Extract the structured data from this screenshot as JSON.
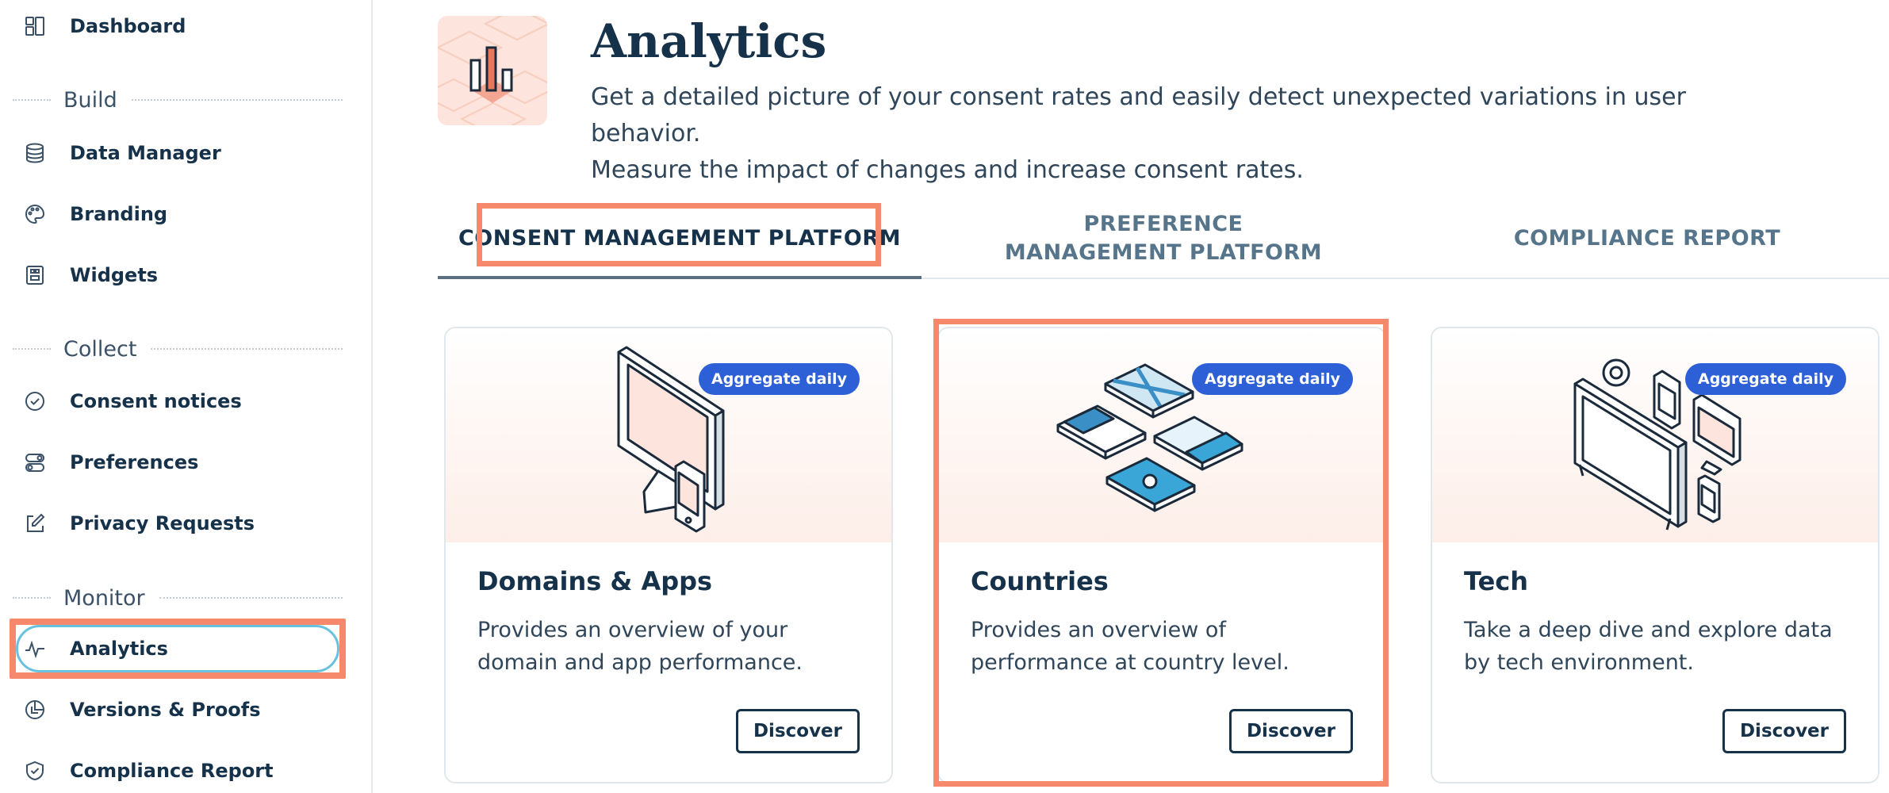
{
  "sidebar": {
    "items_top": [
      {
        "label": "Dashboard",
        "icon": "dashboard-icon"
      }
    ],
    "sections": [
      {
        "label": "Build",
        "items": [
          {
            "label": "Data Manager",
            "icon": "database-icon"
          },
          {
            "label": "Branding",
            "icon": "palette-icon"
          },
          {
            "label": "Widgets",
            "icon": "widgets-icon"
          }
        ]
      },
      {
        "label": "Collect",
        "items": [
          {
            "label": "Consent notices",
            "icon": "check-circle-icon"
          },
          {
            "label": "Preferences",
            "icon": "toggles-icon"
          },
          {
            "label": "Privacy Requests",
            "icon": "edit-icon"
          }
        ]
      },
      {
        "label": "Monitor",
        "items": [
          {
            "label": "Analytics",
            "icon": "pulse-icon",
            "active": true
          },
          {
            "label": "Versions & Proofs",
            "icon": "pie-icon"
          },
          {
            "label": "Compliance Report",
            "icon": "shield-check-icon"
          }
        ]
      }
    ]
  },
  "header": {
    "title": "Analytics",
    "description_line1": "Get a detailed picture of your consent rates and easily detect unexpected variations in user behavior.",
    "description_line2": "Measure the impact of changes and increase consent rates.",
    "icon": "bar-chart-icon"
  },
  "tabs": [
    {
      "label": "CONSENT MANAGEMENT PLATFORM",
      "active": true
    },
    {
      "label": "PREFERENCE MANAGEMENT PLATFORM",
      "active": false
    },
    {
      "label": "COMPLIANCE REPORT",
      "active": false
    }
  ],
  "cards": [
    {
      "title": "Domains & Apps",
      "description": "Provides an overview of your domain and app performance.",
      "badge": "Aggregate daily",
      "button": "Discover",
      "icon": "monitor-phone-icon"
    },
    {
      "title": "Countries",
      "description": "Provides an overview of performance at country level.",
      "badge": "Aggregate daily",
      "button": "Discover",
      "icon": "flags-icon"
    },
    {
      "title": "Tech",
      "description": "Take a deep dive and explore data by tech environment.",
      "badge": "Aggregate daily",
      "button": "Discover",
      "icon": "devices-icon"
    }
  ],
  "colors": {
    "accent": "#f6896b",
    "badge": "#2d5fd6",
    "text": "#16324a",
    "active_pill": "#68c2df"
  }
}
